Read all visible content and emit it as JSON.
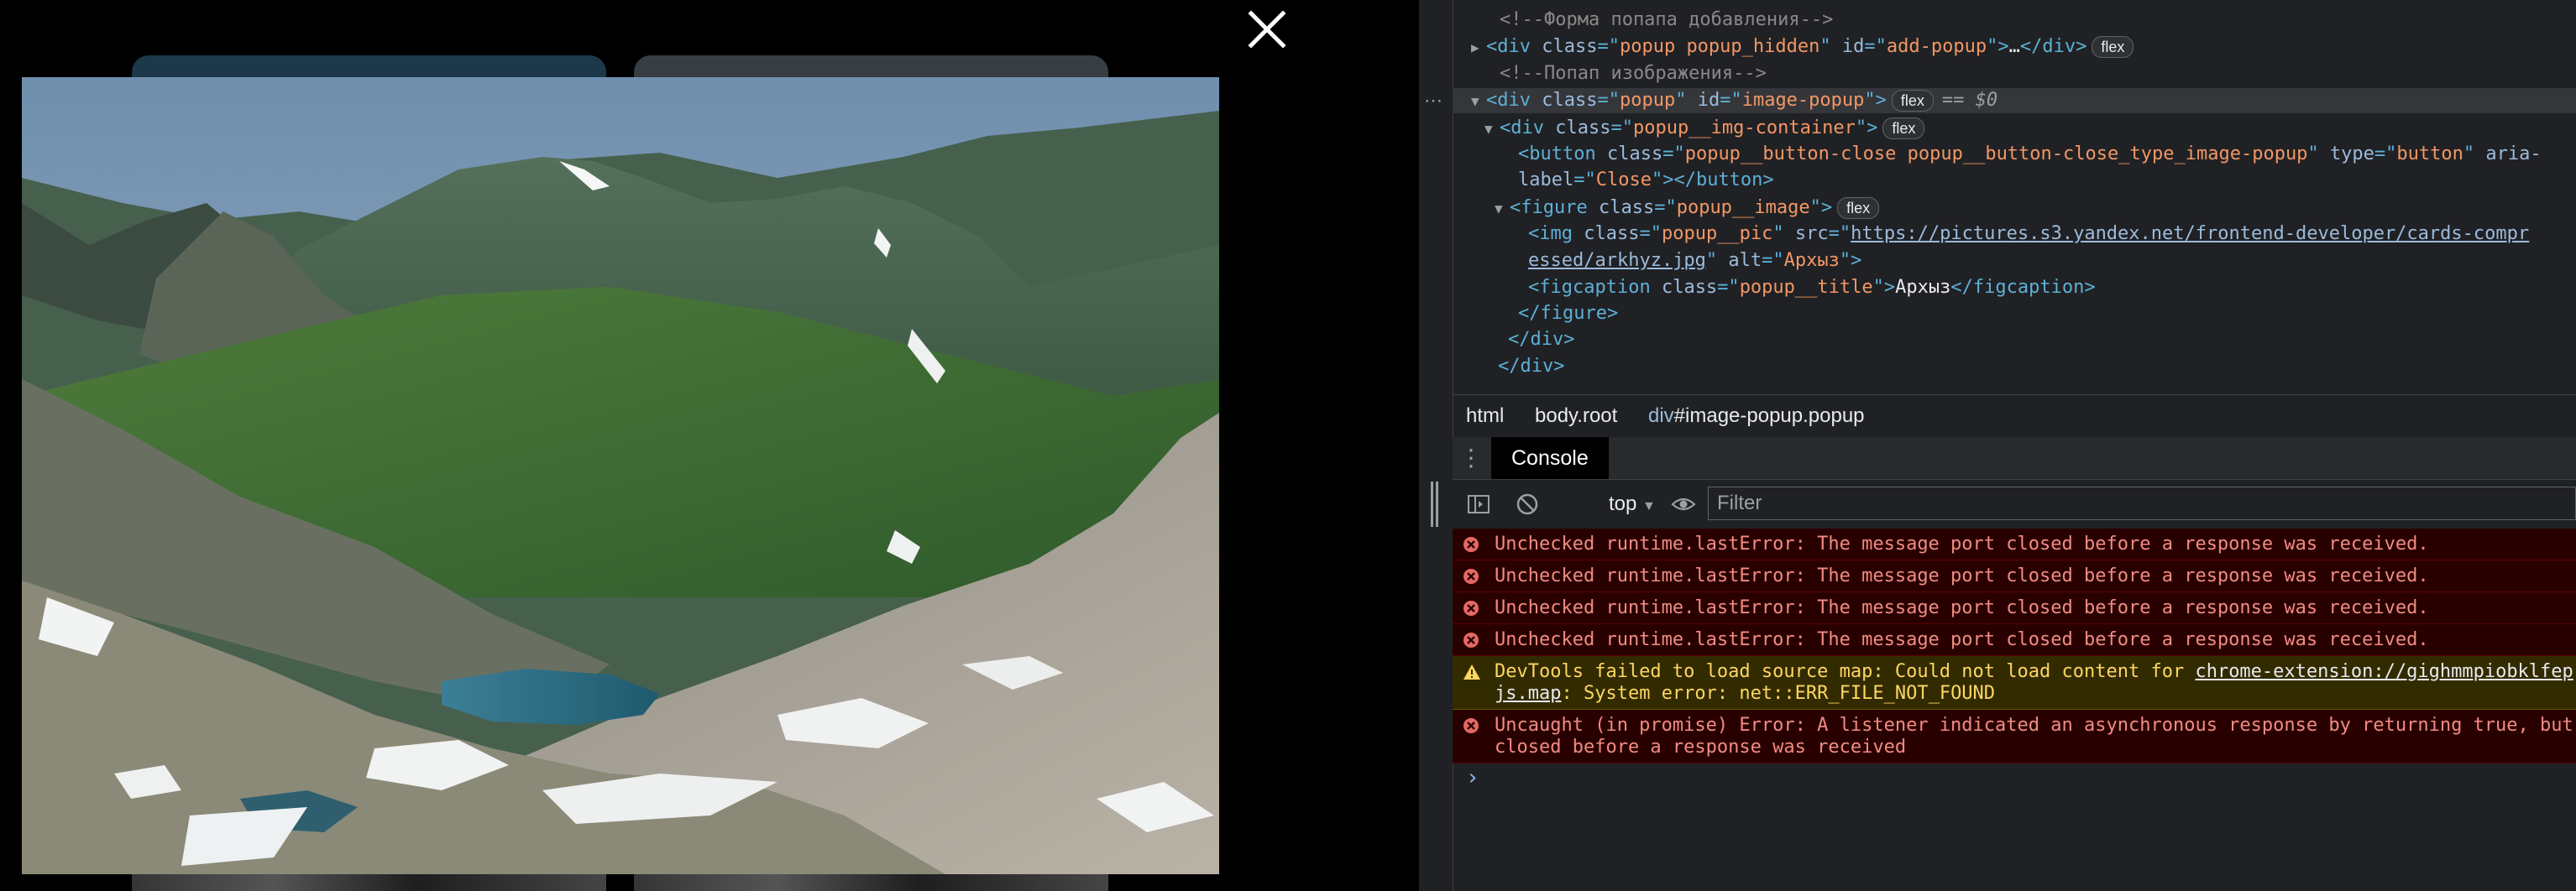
{
  "popup": {
    "image_alt": "Архыз",
    "caption": "Архыз",
    "close_label": "Close"
  },
  "devtools": {
    "elements": {
      "lines": [
        {
          "parts": [
            [
              "comment",
              "<!--Форма попапа добавления-->"
            ]
          ]
        },
        {
          "parts": [
            [
              "tag",
              "<div "
            ],
            [
              "attr-name",
              "class"
            ],
            [
              "tag",
              "=\""
            ],
            [
              "attr-val",
              "popup popup_hidden"
            ],
            [
              "tag",
              "\" "
            ],
            [
              "attr-name",
              "id"
            ],
            [
              "tag",
              "=\""
            ],
            [
              "attr-val",
              "add-popup"
            ],
            [
              "tag",
              "\">"
            ],
            [
              "text-node",
              "…"
            ],
            [
              "tag",
              "</div>"
            ]
          ],
          "badge": "flex",
          "tri": "▶"
        },
        {
          "parts": [
            [
              "comment",
              "<!--Попап изображения-->"
            ]
          ]
        },
        {
          "parts": [
            [
              "tag",
              "<div "
            ],
            [
              "attr-name",
              "class"
            ],
            [
              "tag",
              "=\""
            ],
            [
              "attr-val",
              "popup"
            ],
            [
              "tag",
              "\" "
            ],
            [
              "attr-name",
              "id"
            ],
            [
              "tag",
              "=\""
            ],
            [
              "attr-val",
              "image-popup"
            ],
            [
              "tag",
              "\">"
            ]
          ],
          "badge": "flex",
          "tri": "▼",
          "suffix": "== $0",
          "selected": true
        },
        {
          "parts": [
            [
              "tag",
              "<div "
            ],
            [
              "attr-name",
              "class"
            ],
            [
              "tag",
              "=\""
            ],
            [
              "attr-val",
              "popup__img-container"
            ],
            [
              "tag",
              "\">"
            ]
          ],
          "badge": "flex",
          "tri": "▼"
        },
        {
          "parts": [
            [
              "tag",
              "<button "
            ],
            [
              "attr-name",
              "class"
            ],
            [
              "tag",
              "=\""
            ],
            [
              "attr-val",
              "popup__button-close popup__button-close_type_image-popup"
            ],
            [
              "tag",
              "\" "
            ],
            [
              "attr-name",
              "type"
            ],
            [
              "tag",
              "=\""
            ],
            [
              "attr-val",
              "button"
            ],
            [
              "tag",
              "\" "
            ],
            [
              "attr-name",
              "aria-"
            ]
          ]
        },
        {
          "parts": [
            [
              "attr-name",
              "label"
            ],
            [
              "tag",
              "=\""
            ],
            [
              "attr-val",
              "Close"
            ],
            [
              "tag",
              "\"></button>"
            ]
          ]
        },
        {
          "parts": [
            [
              "tag",
              "<figure "
            ],
            [
              "attr-name",
              "class"
            ],
            [
              "tag",
              "=\""
            ],
            [
              "attr-val",
              "popup__image"
            ],
            [
              "tag",
              "\">"
            ]
          ],
          "badge": "flex",
          "tri": "▼"
        },
        {
          "parts": [
            [
              "tag",
              "<img "
            ],
            [
              "attr-name",
              "class"
            ],
            [
              "tag",
              "=\""
            ],
            [
              "attr-val",
              "popup__pic"
            ],
            [
              "tag",
              "\" "
            ],
            [
              "attr-name",
              "src"
            ],
            [
              "tag",
              "=\""
            ],
            [
              "link",
              "https://pictures.s3.yandex.net/frontend-developer/cards-compr"
            ]
          ]
        },
        {
          "parts": [
            [
              "link",
              "essed/arkhyz.jpg"
            ],
            [
              "tag",
              "\" "
            ],
            [
              "attr-name",
              "alt"
            ],
            [
              "tag",
              "=\""
            ],
            [
              "attr-val",
              "Архыз"
            ],
            [
              "tag",
              "\">"
            ]
          ]
        },
        {
          "parts": [
            [
              "tag",
              "<figcaption "
            ],
            [
              "attr-name",
              "class"
            ],
            [
              "tag",
              "=\""
            ],
            [
              "attr-val",
              "popup__title"
            ],
            [
              "tag",
              "\">"
            ],
            [
              "text-node",
              "Архыз"
            ],
            [
              "tag",
              "</figcaption>"
            ]
          ]
        },
        {
          "parts": [
            [
              "tag",
              "</figure>"
            ]
          ]
        },
        {
          "parts": [
            [
              "tag",
              "</div>"
            ]
          ]
        },
        {
          "parts": [
            [
              "tag",
              "</div>"
            ]
          ]
        }
      ]
    },
    "breadcrumbs": {
      "html": "html",
      "body": "body.root",
      "div_prefix": "div",
      "div_rest": "#image-popup.popup"
    },
    "console": {
      "tab_label": "Console",
      "context": "top",
      "filter_placeholder": "Filter",
      "messages": [
        {
          "type": "error",
          "text": "Unchecked runtime.lastError: The message port closed before a response was received."
        },
        {
          "type": "error",
          "text": "Unchecked runtime.lastError: The message port closed before a response was received."
        },
        {
          "type": "error",
          "text": "Unchecked runtime.lastError: The message port closed before a response was received."
        },
        {
          "type": "error",
          "text": "Unchecked runtime.lastError: The message port closed before a response was received."
        },
        {
          "type": "warning",
          "text_before": "DevTools failed to load source map: Could not load content for ",
          "link": "chrome-extension://gighmmpiobklfep",
          "line2_link": "js.map",
          "line2_rest": ": System error: net::ERR_FILE_NOT_FOUND"
        },
        {
          "type": "error",
          "text": "Uncaught (in promise) Error: A listener indicated an asynchronous response by returning true, but",
          "line2": "closed before a response was received"
        }
      ],
      "prompt": "›"
    }
  }
}
